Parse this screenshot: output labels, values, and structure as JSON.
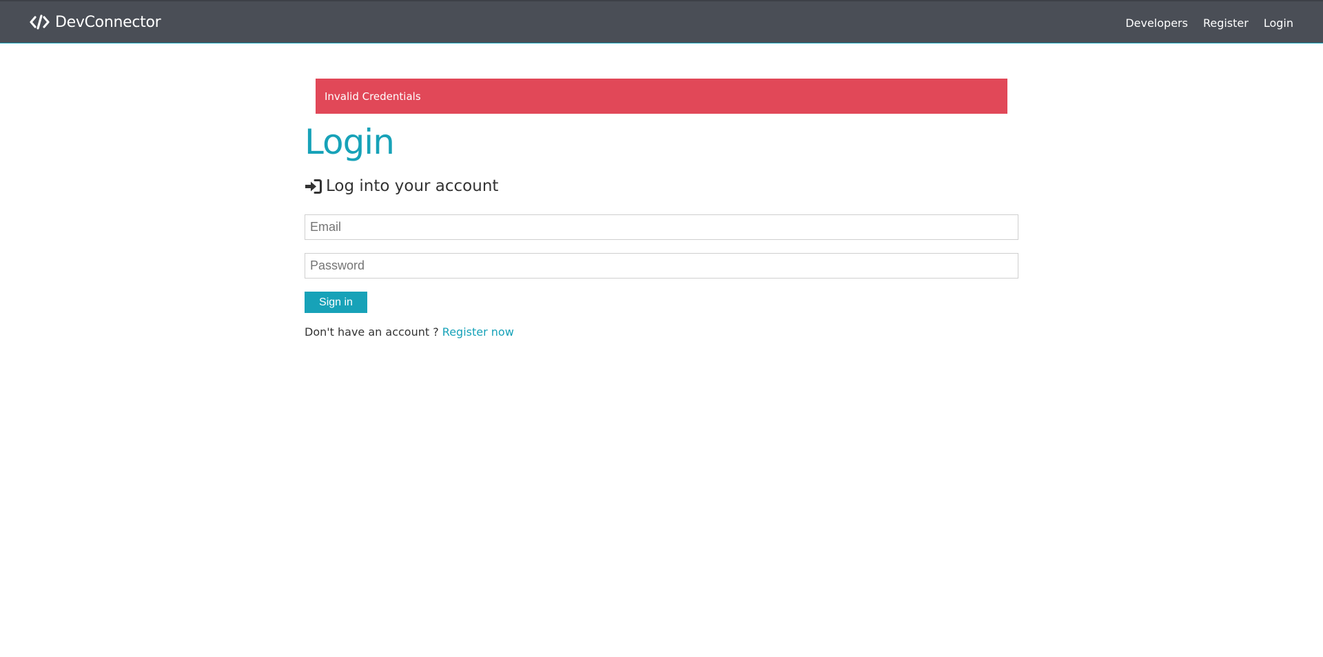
{
  "navbar": {
    "brand": "DevConnector",
    "brand_icon": "code-icon",
    "links": [
      {
        "label": "Developers"
      },
      {
        "label": "Register"
      },
      {
        "label": "Login"
      }
    ],
    "bg_color": "#4a4e56"
  },
  "alert": {
    "text": "Invalid Credentials",
    "color": "#e14858"
  },
  "login": {
    "title": "Login",
    "lead": "Log into your account",
    "lead_icon": "sign-in-icon",
    "email_placeholder": "Email",
    "email_value": "",
    "password_placeholder": "Password",
    "password_value": "",
    "submit_label": "Sign in",
    "register_prompt": "Don't have an account ?",
    "register_link": "Register now",
    "accent_color": "#17a2b8"
  }
}
